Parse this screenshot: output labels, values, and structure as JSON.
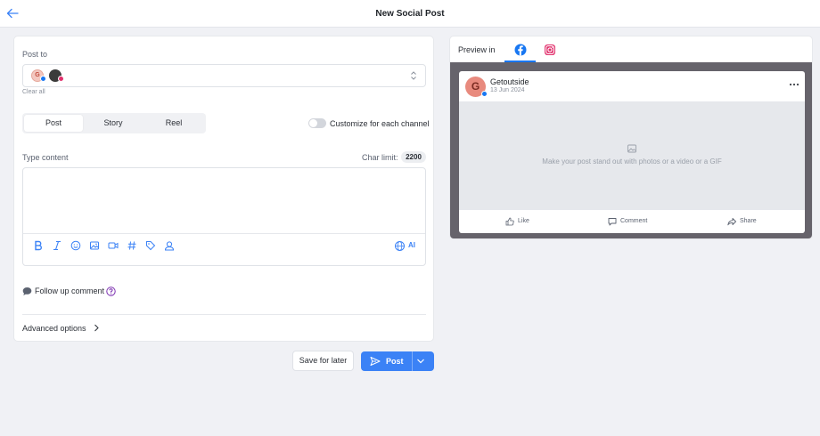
{
  "header": {
    "title": "New Social Post",
    "back_icon": "arrow-left-icon"
  },
  "composer": {
    "post_to_label": "Post to",
    "accounts": [
      {
        "initial": "G",
        "network": "facebook"
      },
      {
        "initial": "",
        "network": "instagram"
      }
    ],
    "clear_all": "Clear all",
    "tabs": [
      "Post",
      "Story",
      "Reel"
    ],
    "selected_tab": "Post",
    "customize_label": "Customize for each channel",
    "customize_enabled": false,
    "content_label": "Type content",
    "char_limit_label": "Char limit:",
    "char_limit_value": "2200",
    "content_value": "",
    "toolbar": {
      "icons": [
        "bold-icon",
        "italic-icon",
        "emoji-icon",
        "image-icon",
        "video-icon",
        "hashtag-icon",
        "tag-icon",
        "mention-icon"
      ],
      "ai_label": "AI"
    },
    "follow_up_label": "Follow up comment",
    "advanced_label": "Advanced options"
  },
  "actions": {
    "save_later": "Save for later",
    "post": "Post"
  },
  "preview": {
    "label": "Preview in",
    "tabs": [
      "facebook",
      "instagram"
    ],
    "active_tab": "facebook",
    "page_name": "Getoutside",
    "page_initial": "G",
    "date": "13 Jun 2024",
    "media_placeholder": "Make your post stand out with photos or a video or a GIF",
    "like": "Like",
    "comment": "Comment",
    "share": "Share"
  },
  "colors": {
    "accent": "#3b82f6",
    "facebook": "#1877f2",
    "instagram": "#e1306c",
    "preview_frame": "#66636b"
  }
}
